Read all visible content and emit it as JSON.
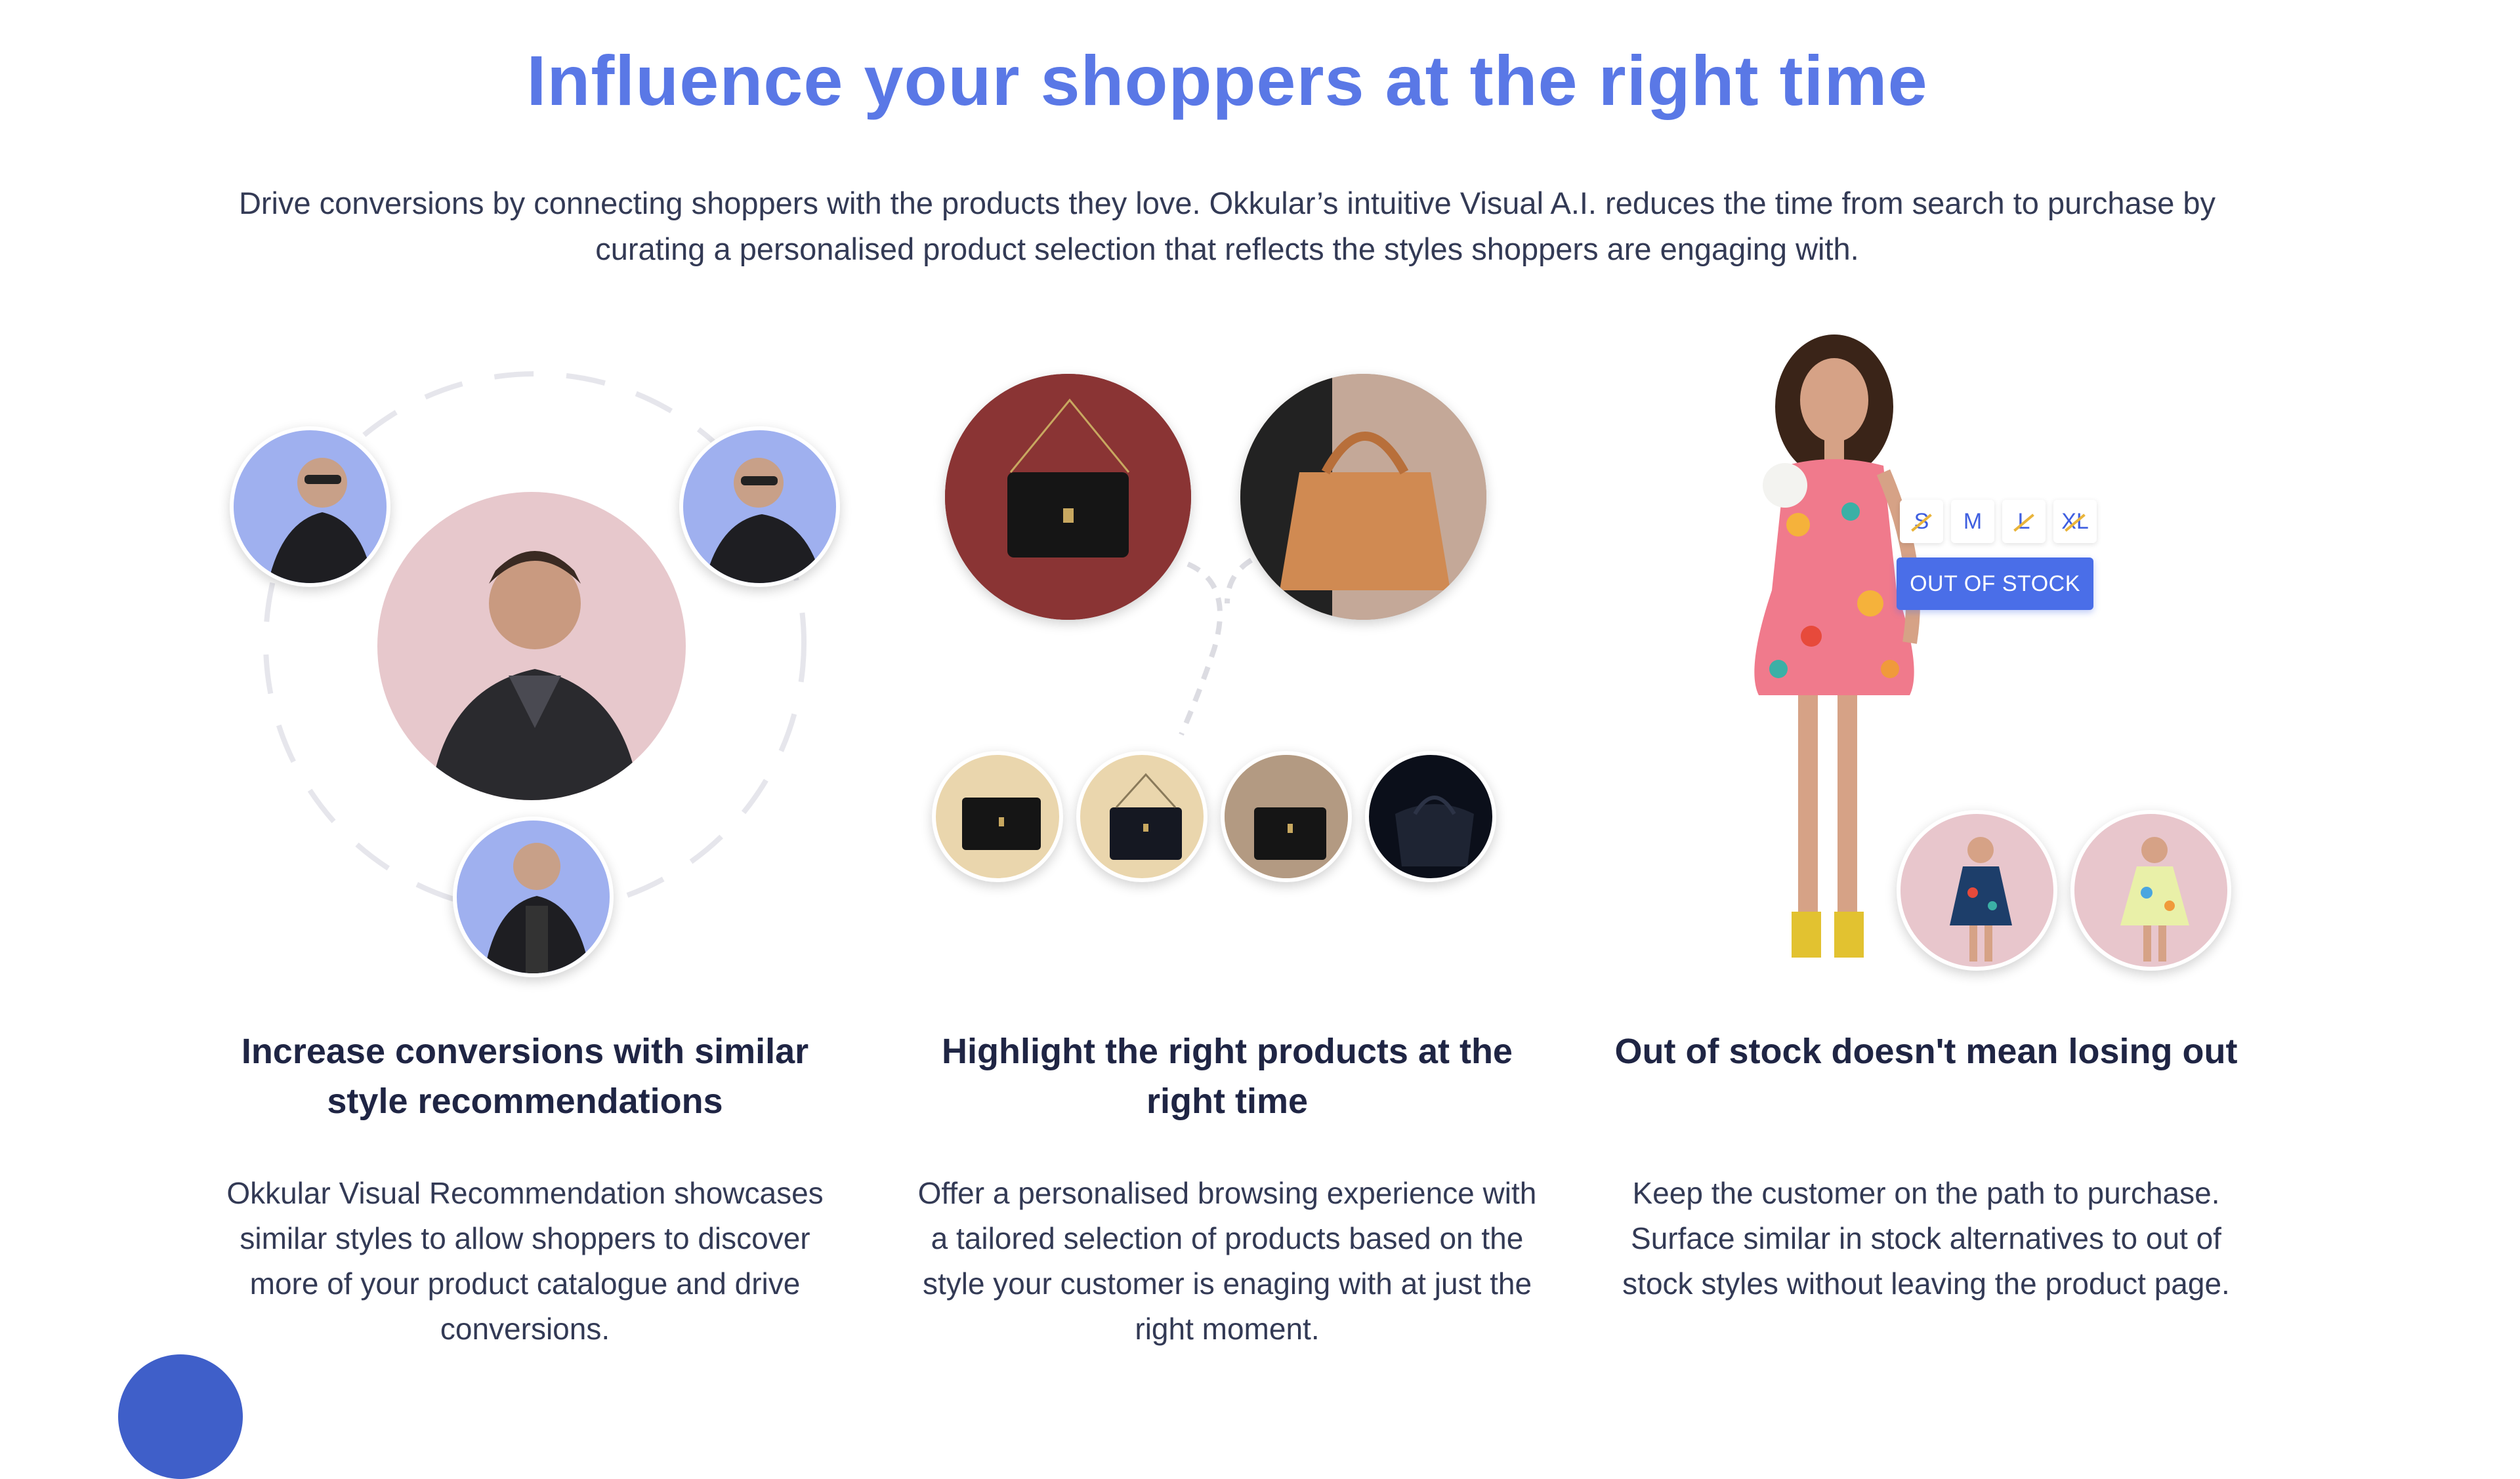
{
  "hero": {
    "title": "Influence your shoppers at the right time",
    "subtitle": "Drive conversions by connecting shoppers with the products they love. Okkular’s intuitive Visual A.I. reduces the time from search to purchase by curating a personalised product selection that reflects the styles shoppers are engaging with."
  },
  "features": [
    {
      "title": "Increase conversions with similar style recommendations",
      "text": "Okkular Visual Recommendation showcases similar styles to allow shoppers to discover more of your product catalogue and drive conversions."
    },
    {
      "title": "Highlight the right products at the right time",
      "text": "Offer a personalised browsing experience with a tailored selection of products based on the style your customer is enaging with at just the right moment."
    },
    {
      "title": "Out of stock doesn't mean losing out",
      "text": "Keep the customer on the path to purchase. Surface similar in stock alternatives to out of stock styles without leaving the product page."
    }
  ],
  "stock_widget": {
    "sizes": [
      "S",
      "M",
      "L",
      "XL"
    ],
    "button_label": "OUT OF STOCK"
  },
  "colors": {
    "accent": "#5a78e6",
    "button": "#4a6ee8",
    "chat": "#3f5fc9"
  }
}
